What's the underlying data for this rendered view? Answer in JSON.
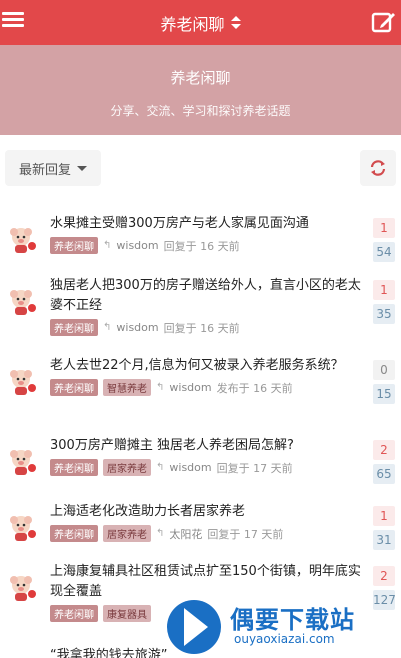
{
  "header": {
    "title": "养老闲聊",
    "menu_icon": "hamburger-menu-icon",
    "compose_icon": "compose-icon"
  },
  "banner": {
    "title": "养老闲聊",
    "subtitle": "分享、交流、学习和探讨养老话题"
  },
  "toolbar": {
    "sort_label": "最新回复",
    "refresh_icon": "refresh-icon"
  },
  "topics": [
    {
      "title": "水果摊主受赠300万房产与老人家属见面沟通",
      "tags": [
        "养老闲聊"
      ],
      "user": "wisdom",
      "time": "回复于 16 天前",
      "replies": "1",
      "views": "54"
    },
    {
      "title": "独居老人把300万的房子赠送给外人，直言小区的老太婆不正经",
      "tags": [
        "养老闲聊"
      ],
      "user": "wisdom",
      "time": "回复于 16 天前",
      "replies": "1",
      "views": "35"
    },
    {
      "title": "老人去世22个月,信息为何又被录入养老服务系统？",
      "tags": [
        "养老闲聊",
        "智慧养老"
      ],
      "user": "wisdom",
      "time": "发布于 16 天前",
      "replies": "0",
      "views": "15"
    },
    {
      "title": "300万房产赠摊主 独居老人养老困局怎解?",
      "tags": [
        "养老闲聊",
        "居家养老"
      ],
      "user": "wisdom",
      "time": "回复于 17 天前",
      "replies": "2",
      "views": "65"
    },
    {
      "title": "上海适老化改造助力长者居家养老",
      "tags": [
        "养老闲聊",
        "居家养老"
      ],
      "user": "太阳花",
      "time": "回复于 17 天前",
      "replies": "1",
      "views": "31"
    },
    {
      "title": "上海康复辅具社区租赁试点扩至150个街镇，明年底实现全覆盖",
      "tags": [
        "养老闲聊",
        "康复器具"
      ],
      "user": "",
      "time": "",
      "replies": "2",
      "views": "127"
    },
    {
      "title": "“我拿我的钱去旅游”",
      "tags": [],
      "user": "",
      "time": "",
      "replies": "",
      "views": ""
    }
  ],
  "watermark": {
    "text": "偶要下载站",
    "url": "ouyaoxiazai.com"
  },
  "colors": {
    "header": "#e2484a",
    "banner": "#d3a2a5",
    "tag": "#c48a8c"
  }
}
